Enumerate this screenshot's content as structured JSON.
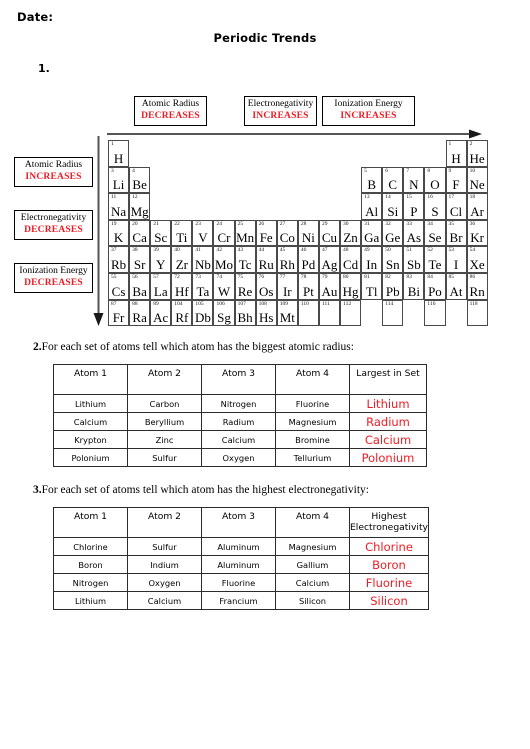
{
  "header": {
    "date_label": "Date:",
    "title": "Periodic Trends"
  },
  "questions": {
    "q1": {
      "number": "1.",
      "text": ""
    },
    "q2": {
      "number": "2.",
      "text": "For each set of atoms tell which atom has the biggest atomic radius:"
    },
    "q3": {
      "number": "3.",
      "text": "For each set of atoms tell which atom has the highest electronegativity:"
    }
  },
  "colors": {
    "answer_red": "#ED1C24",
    "border": "#2b2b2b",
    "cell_border": "#4a4a4a"
  },
  "trends": {
    "horizontal": [
      {
        "name": "Atomic Radius",
        "value": "DECREASES"
      },
      {
        "name": "Electronegativity",
        "value": "INCREASES"
      },
      {
        "name": "Ionization Energy",
        "value": "INCREASES"
      }
    ],
    "vertical": [
      {
        "name": "Atomic Radius",
        "value": "INCREASES"
      },
      {
        "name": "Electronegativity",
        "value": "DECREASES"
      },
      {
        "name": "Ionization Energy",
        "value": "DECREASES"
      }
    ]
  },
  "periodic_table": {
    "columns": 18,
    "rows": [
      [
        {
          "num": "1",
          "sym": "H"
        },
        null,
        null,
        null,
        null,
        null,
        null,
        null,
        null,
        null,
        null,
        null,
        null,
        null,
        null,
        null,
        {
          "num": "1",
          "sym": "H"
        },
        {
          "num": "2",
          "sym": "He"
        }
      ],
      [
        {
          "num": "3",
          "sym": "Li"
        },
        {
          "num": "4",
          "sym": "Be"
        },
        null,
        null,
        null,
        null,
        null,
        null,
        null,
        null,
        null,
        null,
        {
          "num": "5",
          "sym": "B"
        },
        {
          "num": "6",
          "sym": "C"
        },
        {
          "num": "7",
          "sym": "N"
        },
        {
          "num": "8",
          "sym": "O"
        },
        {
          "num": "9",
          "sym": "F"
        },
        {
          "num": "10",
          "sym": "Ne"
        }
      ],
      [
        {
          "num": "11",
          "sym": "Na"
        },
        {
          "num": "12",
          "sym": "Mg"
        },
        null,
        null,
        null,
        null,
        null,
        null,
        null,
        null,
        null,
        null,
        {
          "num": "13",
          "sym": "Al"
        },
        {
          "num": "14",
          "sym": "Si"
        },
        {
          "num": "15",
          "sym": "P"
        },
        {
          "num": "16",
          "sym": "S"
        },
        {
          "num": "17",
          "sym": "Cl"
        },
        {
          "num": "18",
          "sym": "Ar"
        }
      ],
      [
        {
          "num": "19",
          "sym": "K"
        },
        {
          "num": "20",
          "sym": "Ca"
        },
        {
          "num": "21",
          "sym": "Sc"
        },
        {
          "num": "22",
          "sym": "Ti"
        },
        {
          "num": "23",
          "sym": "V"
        },
        {
          "num": "24",
          "sym": "Cr"
        },
        {
          "num": "25",
          "sym": "Mn"
        },
        {
          "num": "26",
          "sym": "Fe"
        },
        {
          "num": "27",
          "sym": "Co"
        },
        {
          "num": "28",
          "sym": "Ni"
        },
        {
          "num": "29",
          "sym": "Cu"
        },
        {
          "num": "30",
          "sym": "Zn"
        },
        {
          "num": "31",
          "sym": "Ga"
        },
        {
          "num": "32",
          "sym": "Ge"
        },
        {
          "num": "33",
          "sym": "As"
        },
        {
          "num": "34",
          "sym": "Se"
        },
        {
          "num": "35",
          "sym": "Br"
        },
        {
          "num": "36",
          "sym": "Kr"
        }
      ],
      [
        {
          "num": "37",
          "sym": "Rb"
        },
        {
          "num": "38",
          "sym": "Sr"
        },
        {
          "num": "39",
          "sym": "Y"
        },
        {
          "num": "40",
          "sym": "Zr"
        },
        {
          "num": "41",
          "sym": "Nb"
        },
        {
          "num": "42",
          "sym": "Mo"
        },
        {
          "num": "43",
          "sym": "Tc"
        },
        {
          "num": "44",
          "sym": "Ru"
        },
        {
          "num": "45",
          "sym": "Rh"
        },
        {
          "num": "46",
          "sym": "Pd"
        },
        {
          "num": "47",
          "sym": "Ag"
        },
        {
          "num": "48",
          "sym": "Cd"
        },
        {
          "num": "49",
          "sym": "In"
        },
        {
          "num": "50",
          "sym": "Sn"
        },
        {
          "num": "51",
          "sym": "Sb"
        },
        {
          "num": "52",
          "sym": "Te"
        },
        {
          "num": "53",
          "sym": "I"
        },
        {
          "num": "54",
          "sym": "Xe"
        }
      ],
      [
        {
          "num": "55",
          "sym": "Cs"
        },
        {
          "num": "56",
          "sym": "Ba"
        },
        {
          "num": "57",
          "sym": "La"
        },
        {
          "num": "72",
          "sym": "Hf"
        },
        {
          "num": "73",
          "sym": "Ta"
        },
        {
          "num": "74",
          "sym": "W"
        },
        {
          "num": "75",
          "sym": "Re"
        },
        {
          "num": "76",
          "sym": "Os"
        },
        {
          "num": "77",
          "sym": "Ir"
        },
        {
          "num": "78",
          "sym": "Pt"
        },
        {
          "num": "79",
          "sym": "Au"
        },
        {
          "num": "80",
          "sym": "Hg"
        },
        {
          "num": "81",
          "sym": "Tl"
        },
        {
          "num": "82",
          "sym": "Pb"
        },
        {
          "num": "83",
          "sym": "Bi"
        },
        {
          "num": "84",
          "sym": "Po"
        },
        {
          "num": "85",
          "sym": "At"
        },
        {
          "num": "86",
          "sym": "Rn"
        }
      ],
      [
        {
          "num": "87",
          "sym": "Fr"
        },
        {
          "num": "88",
          "sym": "Ra"
        },
        {
          "num": "89",
          "sym": "Ac"
        },
        {
          "num": "104",
          "sym": "Rf"
        },
        {
          "num": "105",
          "sym": "Db"
        },
        {
          "num": "106",
          "sym": "Sg"
        },
        {
          "num": "107",
          "sym": "Bh"
        },
        {
          "num": "108",
          "sym": "Hs"
        },
        {
          "num": "109",
          "sym": "Mt"
        },
        {
          "num": "110",
          "sym": ""
        },
        {
          "num": "111",
          "sym": ""
        },
        {
          "num": "112",
          "sym": ""
        },
        null,
        {
          "num": "114",
          "sym": ""
        },
        null,
        {
          "num": "116",
          "sym": ""
        },
        null,
        {
          "num": "118",
          "sym": ""
        }
      ]
    ]
  },
  "table2": {
    "headers": [
      "Atom 1",
      "Atom 2",
      "Atom 3",
      "Atom 4",
      "Largest in Set"
    ],
    "rows": [
      [
        "Lithium",
        "Carbon",
        "Nitrogen",
        "Fluorine",
        "Lithium"
      ],
      [
        "Calcium",
        "Beryllium",
        "Radium",
        "Magnesium",
        "Radium"
      ],
      [
        "Krypton",
        "Zinc",
        "Calcium",
        "Bromine",
        "Calcium"
      ],
      [
        "Polonium",
        "Sulfur",
        "Oxygen",
        "Tellurium",
        "Polonium"
      ]
    ]
  },
  "table3": {
    "headers": [
      "Atom 1",
      "Atom 2",
      "Atom 3",
      "Atom 4",
      "Highest Electronegativity"
    ],
    "rows": [
      [
        "Chlorine",
        "Sulfur",
        "Aluminum",
        "Magnesium",
        "Chlorine"
      ],
      [
        "Boron",
        "Indium",
        "Aluminum",
        "Gallium",
        "Boron"
      ],
      [
        "Nitrogen",
        "Oxygen",
        "Fluorine",
        "Calcium",
        "Fluorine"
      ],
      [
        "Lithium",
        "Calcium",
        "Francium",
        "Silicon",
        "Silicon"
      ]
    ]
  }
}
